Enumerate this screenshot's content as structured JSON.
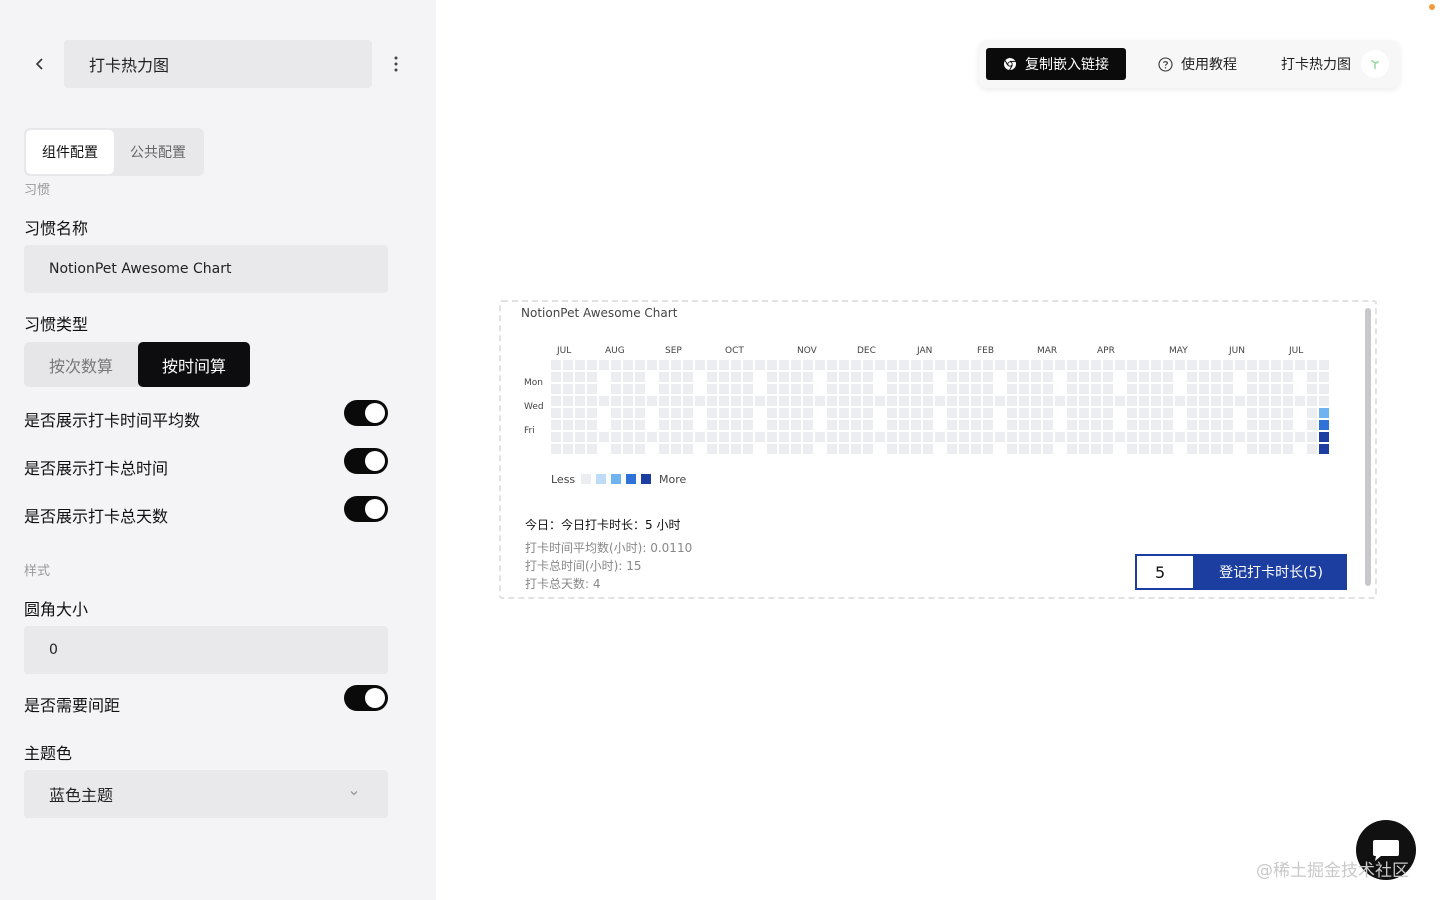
{
  "sidebar": {
    "title": "打卡热力图",
    "tabs": [
      {
        "label": "组件配置"
      },
      {
        "label": "公共配置"
      }
    ],
    "section_habit": "习惯",
    "habit_name_label": "习惯名称",
    "habit_name_value": "NotionPet Awesome Chart",
    "habit_type_label": "习惯类型",
    "habit_type_options": [
      "按次数算",
      "按时间算"
    ],
    "habit_type_selected": "按时间算",
    "toggles": [
      {
        "label": "是否展示打卡时间平均数",
        "on": true
      },
      {
        "label": "是否展示打卡总时间",
        "on": true
      },
      {
        "label": "是否展示打卡总天数",
        "on": true
      }
    ],
    "section_style": "样式",
    "radius_label": "圆角大小",
    "radius_value": "0",
    "spacing_toggle": {
      "label": "是否需要间距",
      "on": true
    },
    "theme_label": "主题色",
    "theme_value": "蓝色主题"
  },
  "toolbar": {
    "copy_label": "复制嵌入链接",
    "tutorial_label": "使用教程",
    "title": "打卡热力图"
  },
  "chart_card": {
    "title": "NotionPet Awesome Chart",
    "legend_less": "Less",
    "legend_more": "More",
    "today_text": "今日：今日打卡时长：5 小时",
    "avg_text": "打卡时间平均数(小时): 0.0110",
    "total_text": "打卡总时间(小时): 15",
    "days_text": "打卡总天数: 4",
    "input_value": "5",
    "button_label": "登记打卡时长(5)"
  },
  "chart_data": {
    "type": "heatmap",
    "title": "NotionPet Awesome Chart",
    "months": [
      "JUL",
      "AUG",
      "SEP",
      "OCT",
      "NOV",
      "DEC",
      "JAN",
      "FEB",
      "MAR",
      "APR",
      "MAY",
      "JUN",
      "JUL"
    ],
    "day_labels": [
      "Mon",
      "Wed",
      "Fri"
    ],
    "legend": [
      "Less",
      "More"
    ],
    "colors": [
      "#ebedf0",
      "#bfdcf7",
      "#6fb3f0",
      "#2f72d8",
      "#1b3ea0"
    ],
    "active_days": [
      {
        "week": 64,
        "weekday": 4,
        "level": 2
      },
      {
        "week": 64,
        "weekday": 5,
        "level": 3
      },
      {
        "week": 64,
        "weekday": 6,
        "level": 4
      },
      {
        "week": 64,
        "weekday": 7,
        "level": 4
      }
    ]
  },
  "watermark": "@稀土掘金技术社区",
  "colors": {
    "accent": "#1b3ea0",
    "toggle_on": "#0a0a0a",
    "sidebar_bg": "#f4f4f6"
  }
}
